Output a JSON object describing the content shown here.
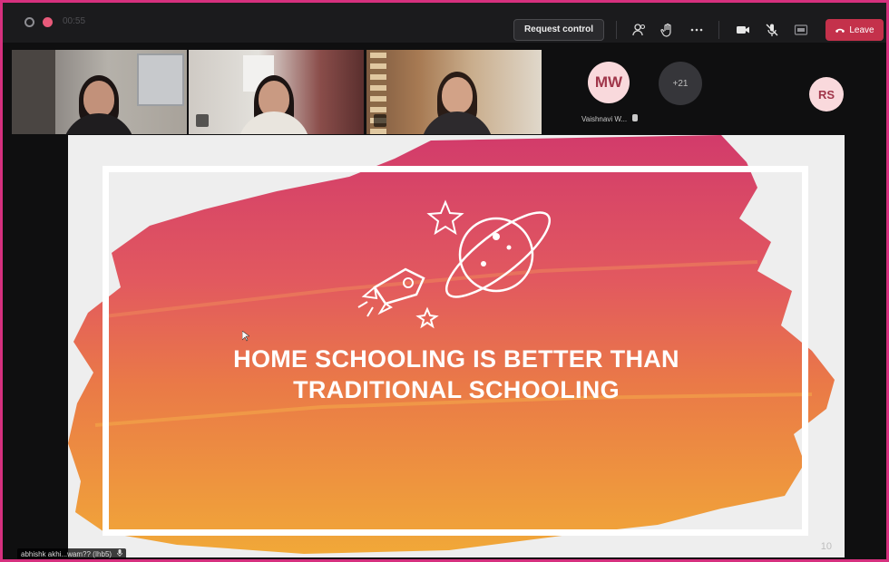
{
  "topbar": {
    "meeting_timer": "00:55",
    "request_control_label": "Request control",
    "leave_label": "Leave"
  },
  "participants": {
    "avatar_mw_initials": "MW",
    "avatar_mw_name": "Vaishnavi W...",
    "more_count": "+21",
    "avatar_rs_initials": "RS"
  },
  "slide": {
    "title_line1": "HOME SCHOOLING IS BETTER THAN",
    "title_line2": "TRADITIONAL SCHOOLING",
    "page_number": "10"
  },
  "presenter": {
    "name": "abhishk akhi...wam?? (Ihb5)"
  },
  "colors": {
    "frame_border": "#d6307e",
    "leave_button": "#c4314b",
    "avatar_bg": "#f9d9dc",
    "brush_top": "#d8406a",
    "brush_bottom": "#f0a038"
  },
  "icons": [
    "people-icon",
    "raise-hand-icon",
    "more-options-icon",
    "camera-icon",
    "mic-off-icon",
    "share-tray-icon",
    "phone-hangup-icon",
    "mic-icon"
  ]
}
